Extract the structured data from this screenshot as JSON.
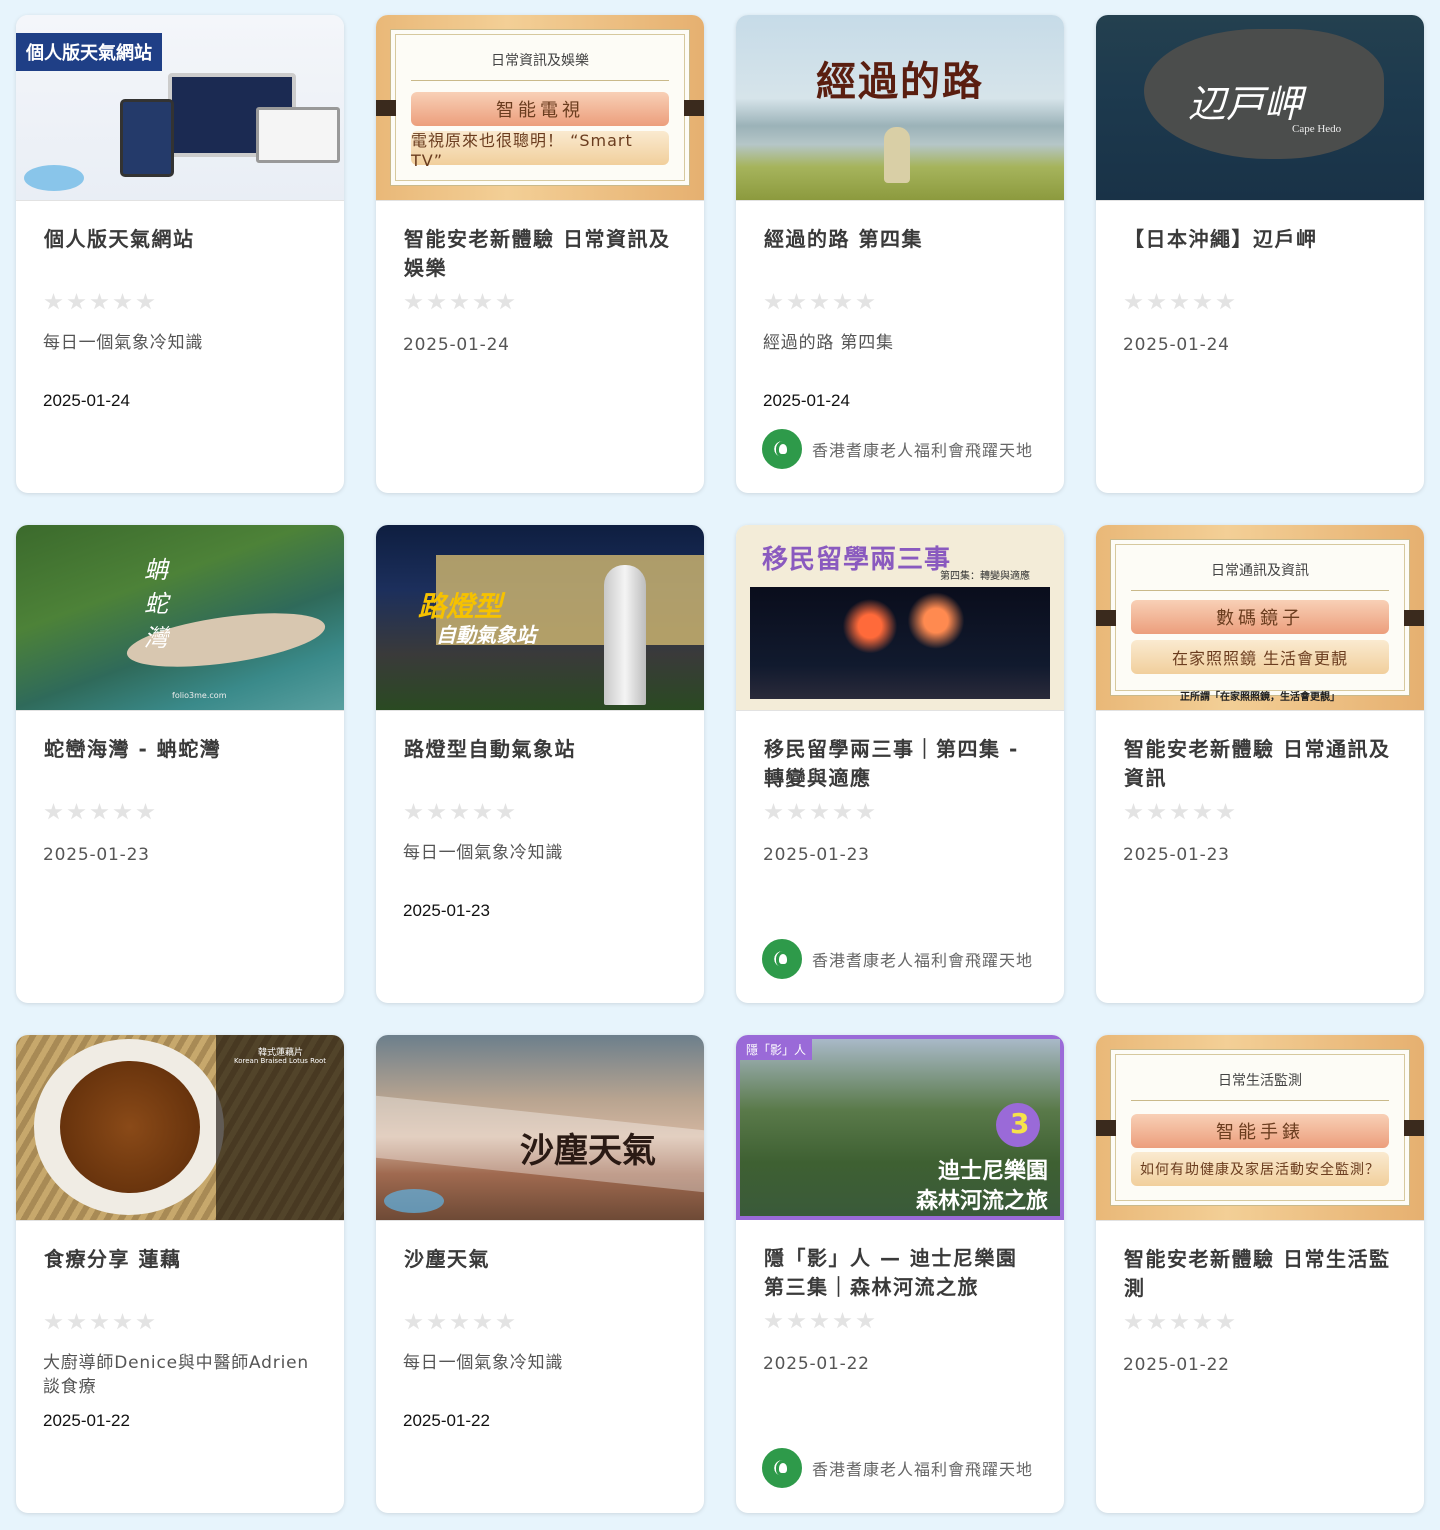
{
  "cards": [
    {
      "title": "個人版天氣網站",
      "desc": "每日一個氣象冷知識",
      "date": "2025-01-24",
      "org": "",
      "thumb_label": "個人版天氣網站"
    },
    {
      "title": "智能安老新體驗 日常資訊及娛樂",
      "desc": "",
      "date": "2025-01-24",
      "org": "",
      "thumb_header": "日常資訊及娛樂",
      "thumb_pill_a": "智能電視",
      "thumb_pill_b": "電視原來也很聰明！ “Smart TV”"
    },
    {
      "title": "經過的路 第四集",
      "desc": "經過的路 第四集",
      "date": "2025-01-24",
      "org": "香港耆康老人福利會飛躍天地",
      "thumb_label": "經過的路"
    },
    {
      "title": "【日本沖繩】辺戶岬",
      "desc": "",
      "date": "2025-01-24",
      "org": "",
      "thumb_label": "辺戸岬",
      "thumb_sub": "Cape Hedo"
    },
    {
      "title": "蛇巒海灣 - 蚺蛇灣",
      "desc": "",
      "date": "2025-01-23",
      "org": "",
      "thumb_label": "蚺蛇灣",
      "thumb_sub": "folio3me.com"
    },
    {
      "title": "路燈型自動氣象站",
      "desc": "每日一個氣象冷知識",
      "date": "2025-01-23",
      "org": "",
      "thumb_label": "路燈型",
      "thumb_sub": "自動氣象站"
    },
    {
      "title": "移民留學兩三事｜第四集 - 轉變與適應",
      "desc": "",
      "date": "2025-01-23",
      "org": "香港耆康老人福利會飛躍天地",
      "thumb_label": "移民留學兩三事",
      "thumb_sub": "第四集：轉變與適應"
    },
    {
      "title": "智能安老新體驗 日常通訊及資訊",
      "desc": "",
      "date": "2025-01-23",
      "org": "",
      "thumb_header": "日常通訊及資訊",
      "thumb_pill_a": "數碼鏡子",
      "thumb_pill_b": "在家照照鏡 生活會更靚",
      "thumb_caption": "正所謂「在家照照鏡，生活會更靚」"
    },
    {
      "title": "食療分享 蓮藕",
      "desc": "大廚導師Denice與中醫師Adrien談食療",
      "date": "2025-01-22",
      "org": "",
      "thumb_label": "韓式蓮藕片",
      "thumb_sub": "Korean Braised Lotus Root"
    },
    {
      "title": "沙塵天氣",
      "desc": "每日一個氣象冷知識",
      "date": "2025-01-22",
      "org": "",
      "thumb_label": "沙塵天氣"
    },
    {
      "title": "隱「影」人 — 迪士尼樂園 第三集｜森林河流之旅",
      "desc": "",
      "date": "2025-01-22",
      "org": "香港耆康老人福利會飛躍天地",
      "thumb_tag": "隱「影」人",
      "thumb_num": "3",
      "thumb_label": "迪士尼樂園",
      "thumb_sub": "森林河流之旅"
    },
    {
      "title": "智能安老新體驗 日常生活監測",
      "desc": "",
      "date": "2025-01-22",
      "org": "",
      "thumb_header": "日常生活監測",
      "thumb_pill_a": "智能手錶",
      "thumb_pill_b": "如何有助健康及家居活動安全監測？"
    }
  ]
}
